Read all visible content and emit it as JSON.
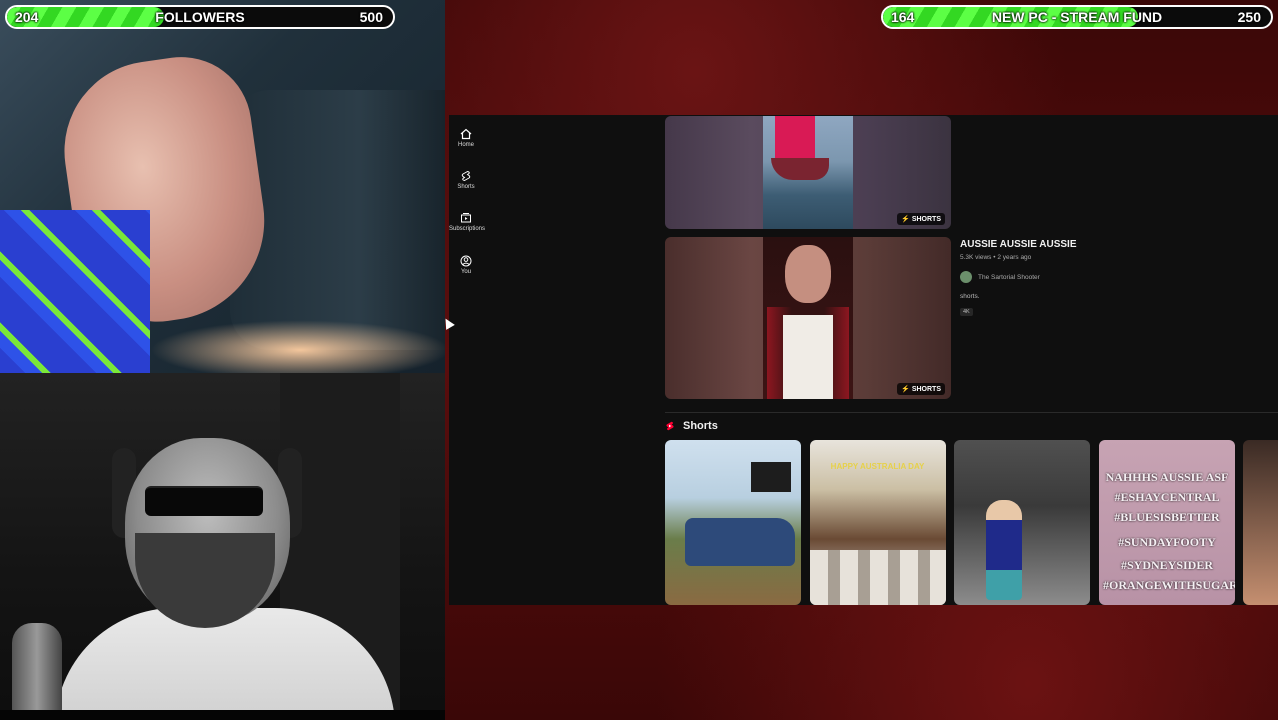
{
  "overlay": {
    "followers_goal": {
      "current": "204",
      "title": "FOLLOWERS",
      "target": "500",
      "progress": 0.408
    },
    "pc_goal": {
      "current": "164",
      "title": "NEW PC - STREAM FUND",
      "target": "250",
      "progress": 0.656
    }
  },
  "sidebar": {
    "items": [
      {
        "label": "Home",
        "icon": "home-icon"
      },
      {
        "label": "Shorts",
        "icon": "shorts-icon"
      },
      {
        "label": "Subscriptions",
        "icon": "subscriptions-icon"
      },
      {
        "label": "You",
        "icon": "user-icon"
      }
    ]
  },
  "videos": [
    {
      "badge": "SHORTS"
    },
    {
      "badge": "SHORTS",
      "title": "AUSSIE AUSSIE AUSSIE",
      "views": "5.3K views • 2 years ago",
      "channel": "The Sartorial Shooter",
      "description": "shorts.",
      "quality": "4K"
    }
  ],
  "shorts_section": {
    "title": "Shorts",
    "items": [
      {
        "overlay_text": ""
      },
      {
        "overlay_text": "HAPPY AUSTRALIA DAY"
      },
      {
        "overlay_text": ""
      },
      {
        "overlay_lines": [
          "NAHHHS AUSSIE ASF",
          "#ESHAYCENTRAL",
          "#BLUESISBETTER",
          "#SUNDAYFOOTY",
          "#SYDNEYSIDER",
          "#ORANGEWITHSUGAR"
        ]
      }
    ]
  },
  "colors": {
    "goal_fill": "#5cff45",
    "shorts_red": "#ff0033",
    "yt_bg": "#0f0f0f"
  }
}
